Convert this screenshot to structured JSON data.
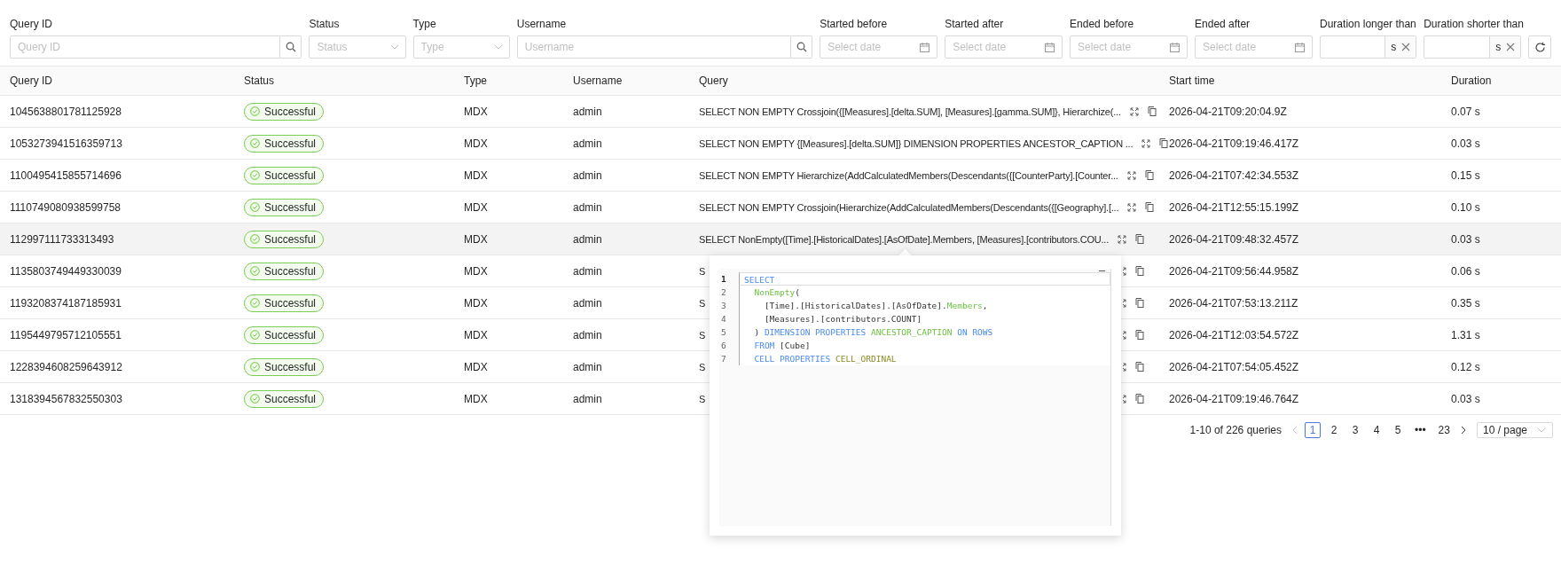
{
  "filters": [
    {
      "kind": "search",
      "label": "Query ID",
      "placeholder": "Query ID"
    },
    {
      "kind": "select",
      "label": "Status",
      "placeholder": "Status"
    },
    {
      "kind": "select",
      "label": "Type",
      "placeholder": "Type"
    },
    {
      "kind": "search",
      "label": "Username",
      "placeholder": "Username"
    },
    {
      "kind": "date",
      "label": "Started before",
      "placeholder": "Select date"
    },
    {
      "kind": "date",
      "label": "Started after",
      "placeholder": "Select date"
    },
    {
      "kind": "date",
      "label": "Ended before",
      "placeholder": "Select date"
    },
    {
      "kind": "date",
      "label": "Ended after",
      "placeholder": "Select date"
    },
    {
      "kind": "duration",
      "label": "Duration longer than",
      "unit": "s"
    },
    {
      "kind": "duration",
      "label": "Duration shorter than",
      "unit": "s"
    }
  ],
  "table": {
    "columns": [
      "Query ID",
      "Status",
      "Type",
      "Username",
      "Query",
      "Start time",
      "Duration"
    ],
    "rows": [
      {
        "id": "1045638801781125928",
        "status": "Successful",
        "type": "MDX",
        "username": "admin",
        "query": "SELECT NON EMPTY Crossjoin({[Measures].[delta.SUM], [Measures].[gamma.SUM]}, Hierarchize(...",
        "start": "2026-04-21T09:20:04.9Z",
        "duration": "0.07 s",
        "highlighted": false
      },
      {
        "id": "1053273941516359713",
        "status": "Successful",
        "type": "MDX",
        "username": "admin",
        "query": "SELECT NON EMPTY {[Measures].[delta.SUM]} DIMENSION PROPERTIES ANCESTOR_CAPTION ...",
        "start": "2026-04-21T09:19:46.417Z",
        "duration": "0.03 s",
        "highlighted": false
      },
      {
        "id": "1100495415855714696",
        "status": "Successful",
        "type": "MDX",
        "username": "admin",
        "query": "SELECT NON EMPTY Hierarchize(AddCalculatedMembers(Descendants({[CounterParty].[Counter...",
        "start": "2026-04-21T07:42:34.553Z",
        "duration": "0.15 s",
        "highlighted": false
      },
      {
        "id": "1110749080938599758",
        "status": "Successful",
        "type": "MDX",
        "username": "admin",
        "query": "SELECT NON EMPTY Crossjoin(Hierarchize(AddCalculatedMembers(Descendants({[Geography].[...",
        "start": "2026-04-21T12:55:15.199Z",
        "duration": "0.10 s",
        "highlighted": false
      },
      {
        "id": "112997111733313493",
        "status": "Successful",
        "type": "MDX",
        "username": "admin",
        "query": "SELECT NonEmpty([Time].[HistoricalDates].[AsOfDate].Members, [Measures].[contributors.COU...",
        "start": "2026-04-21T09:48:32.457Z",
        "duration": "0.03 s",
        "highlighted": true
      },
      {
        "id": "1135803749449330039",
        "status": "Successful",
        "type": "MDX",
        "username": "admin",
        "query": "S",
        "start": "2026-04-21T09:56:44.958Z",
        "duration": "0.06 s",
        "highlighted": false
      },
      {
        "id": "1193208374187185931",
        "status": "Successful",
        "type": "MDX",
        "username": "admin",
        "query": "S",
        "start": "2026-04-21T07:53:13.211Z",
        "duration": "0.35 s",
        "highlighted": false
      },
      {
        "id": "1195449795712105551",
        "status": "Successful",
        "type": "MDX",
        "username": "admin",
        "query": "S",
        "start": "2026-04-21T12:03:54.572Z",
        "duration": "1.31 s",
        "highlighted": false
      },
      {
        "id": "1228394608259643912",
        "status": "Successful",
        "type": "MDX",
        "username": "admin",
        "query": "S",
        "start": "2026-04-21T07:54:05.452Z",
        "duration": "0.12 s",
        "highlighted": false
      },
      {
        "id": "1318394567832550303",
        "status": "Successful",
        "type": "MDX",
        "username": "admin",
        "query": "S",
        "start": "2026-04-21T09:19:46.764Z",
        "duration": "0.03 s",
        "highlighted": false
      }
    ]
  },
  "pagination": {
    "summary": "1-10 of 226 queries",
    "pages": [
      {
        "label": "1",
        "selected": true
      },
      {
        "label": "2",
        "selected": false
      },
      {
        "label": "3",
        "selected": false
      },
      {
        "label": "4",
        "selected": false
      },
      {
        "label": "5",
        "selected": false
      },
      {
        "label": "•••",
        "selected": false
      },
      {
        "label": "23",
        "selected": false
      }
    ],
    "page_size": "10 / page"
  },
  "popover": {
    "lines": [
      {
        "number": "1",
        "active": true,
        "tokens": [
          {
            "text": "SELECT",
            "kind": "keyword"
          }
        ]
      },
      {
        "number": "2",
        "active": false,
        "tokens": [
          {
            "text": "  NonEmpty",
            "kind": "function"
          },
          {
            "text": "(",
            "kind": "plain"
          }
        ]
      },
      {
        "number": "3",
        "active": false,
        "tokens": [
          {
            "text": "    [Time].[HistoricalDates].[AsOfDate].",
            "kind": "plain"
          },
          {
            "text": "Members",
            "kind": "function"
          },
          {
            "text": ",",
            "kind": "plain"
          }
        ]
      },
      {
        "number": "4",
        "active": false,
        "tokens": [
          {
            "text": "    [Measures].[contributors.COUNT]",
            "kind": "plain"
          }
        ]
      },
      {
        "number": "5",
        "active": false,
        "tokens": [
          {
            "text": "  ) ",
            "kind": "plain"
          },
          {
            "text": "DIMENSION PROPERTIES ",
            "kind": "keyword"
          },
          {
            "text": "ANCESTOR_CAPTION ",
            "kind": "function"
          },
          {
            "text": "ON ROWS",
            "kind": "keyword"
          }
        ]
      },
      {
        "number": "6",
        "active": false,
        "tokens": [
          {
            "text": "  FROM",
            "kind": "keyword"
          },
          {
            "text": " [Cube]",
            "kind": "plain"
          }
        ]
      },
      {
        "number": "7",
        "active": false,
        "tokens": [
          {
            "text": "  CELL PROPERTIES ",
            "kind": "keyword"
          },
          {
            "text": "CELL_ORDINAL",
            "kind": "constant"
          }
        ]
      }
    ]
  }
}
